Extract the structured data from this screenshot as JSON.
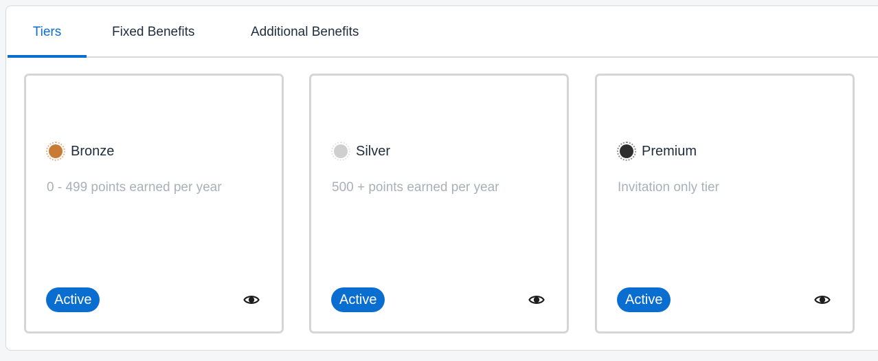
{
  "tabs": [
    {
      "label": "Tiers",
      "active": true
    },
    {
      "label": "Fixed Benefits",
      "active": false
    },
    {
      "label": "Additional Benefits",
      "active": false
    }
  ],
  "tiers": [
    {
      "name": "Bronze",
      "description": "0 - 499 points earned per year",
      "status": "Active",
      "medal_color": "#c97a35",
      "icon": "eye-icon"
    },
    {
      "name": "Silver",
      "description": "500 + points earned per year",
      "status": "Active",
      "medal_color": "#cfcfcf",
      "icon": "eye-icon"
    },
    {
      "name": "Premium",
      "description": "Invitation only tier",
      "status": "Active",
      "medal_color": "#2e2e2e",
      "icon": "eye-icon"
    }
  ],
  "colors": {
    "accent": "#0a6ed1",
    "text": "#1d2d3e",
    "muted_text": "#a9b0b7",
    "card_border": "#d5d5d5"
  }
}
